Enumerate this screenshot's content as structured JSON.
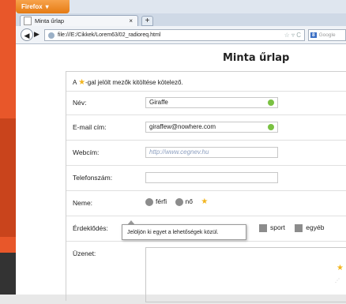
{
  "browser": {
    "menu_button": "Firefox",
    "tab_title": "Minta űrlap",
    "tab_close": "×",
    "new_tab": "+",
    "url": "file:///E:/Cikkek/Lorem63/02_radioreq.html",
    "search_placeholder": "Google"
  },
  "page": {
    "title": "Minta űrlap",
    "required_note_prefix": "A ",
    "required_note_suffix": "-gal jelölt mezők kitöltése kötelező.",
    "fields": {
      "name_label": "Név:",
      "name_value": "Giraffe",
      "email_label": "E-mail cím:",
      "email_value": "giraffew@nowhere.com",
      "web_label": "Webcím:",
      "web_placeholder": "http://www.cegnev.hu",
      "phone_label": "Telefonszám:",
      "gender_label": "Neme:",
      "gender_male": "férfi",
      "gender_female": "nő",
      "interest_label": "Érdeklődés:",
      "interest_sport": "sport",
      "interest_other": "egyéb",
      "message_label": "Üzenet:"
    },
    "tooltip": "Jelöljön ki egyet a lehetőségek közül."
  },
  "colors": {
    "accent": "#e57b13",
    "required_star": "#f2b51f",
    "valid": "#7ac142"
  }
}
